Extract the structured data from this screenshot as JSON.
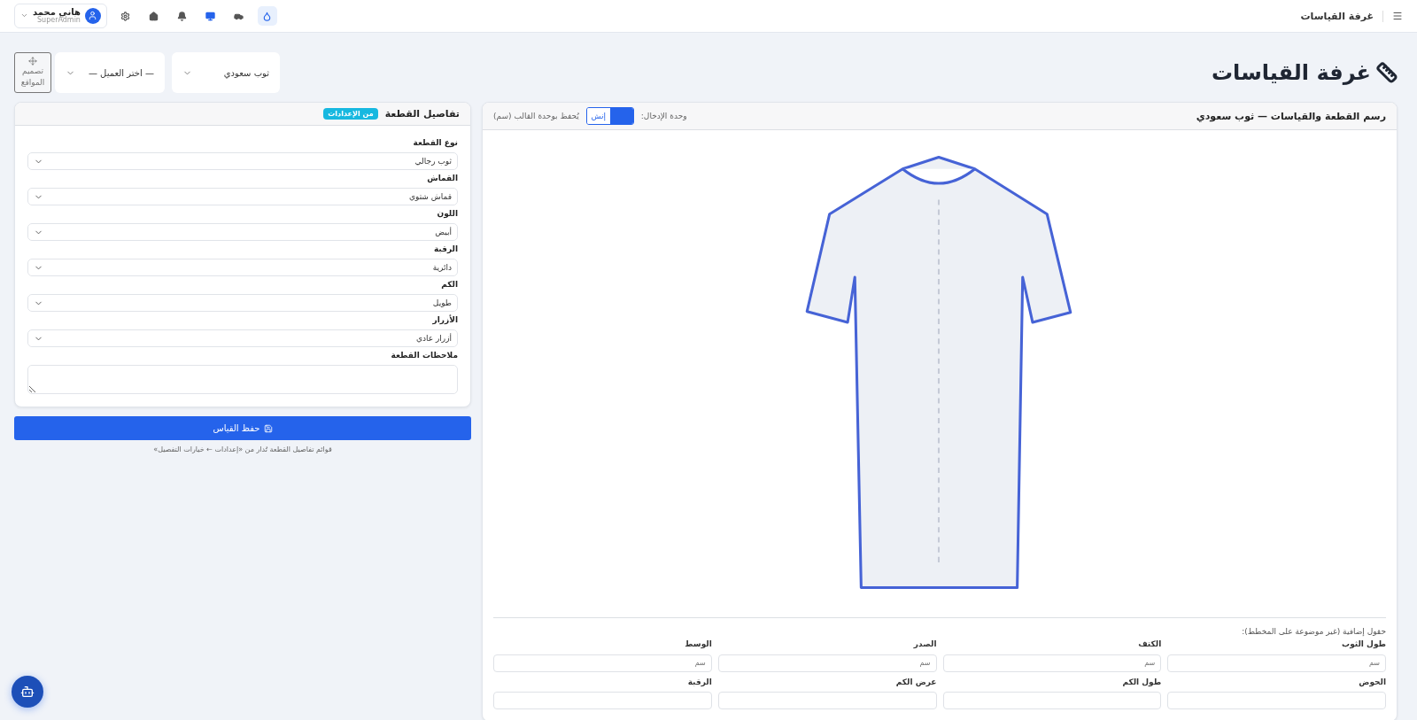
{
  "topbar": {
    "title": "غرفة القياسات",
    "user": {
      "name": "هاني محمد",
      "role": "SuperAdmin"
    },
    "toolbar_icons": [
      {
        "selected": false
      },
      {
        "selected": false
      },
      {
        "selected": false
      },
      {
        "selected": false
      },
      {
        "selected": false
      },
      {
        "selected": true
      }
    ]
  },
  "page_title": "غرفة القياسات",
  "header_controls": {
    "garment_select": "ثوب سعودي",
    "client_select": "— اختر العميل —",
    "layout_button": "تصميم المواقع"
  },
  "drawing_panel": {
    "title": "رسم القطعة والقياسات — ثوب سعودي",
    "unit_label": "وحدة الإدخال:",
    "unit_toggle": [
      {
        "label": "إنش",
        "selected": false
      },
      {
        "selected": true
      }
    ],
    "unit_note": "يُحفظ بوحدة القالب (سم)",
    "extra_heading": "حقول إضافية (غير موضوعة على المخطط):",
    "fields": [
      {
        "label": "طول الثوب",
        "placeholder": "سم"
      },
      {
        "label": "الكتف",
        "placeholder": "سم"
      },
      {
        "label": "الصدر",
        "placeholder": "سم"
      },
      {
        "label": "الوسط",
        "placeholder": "سم"
      },
      {
        "label": "الحوض"
      },
      {
        "label": "طول الكم"
      },
      {
        "label": "عرض الكم"
      },
      {
        "label": "الرقبة"
      }
    ]
  },
  "details_panel": {
    "title": "تفاصيل القطعة",
    "badge": "من الإعدادات",
    "selects": [
      {
        "label": "نوع القطعة",
        "value": "ثوب رجالي"
      },
      {
        "label": "القماش",
        "value": "قماش شتوي"
      },
      {
        "label": "اللون",
        "value": "أبيض"
      },
      {
        "label": "الرقبة",
        "value": "دائرية"
      },
      {
        "label": "الكم",
        "value": "طويل"
      },
      {
        "label": "الأزرار",
        "value": "أزرار عادي"
      }
    ],
    "notes_label": "ملاحظات القطعة"
  },
  "save_button": "حفظ القياس",
  "footnote": "قوائم تفاصيل القطعة تُدار من «إعدادات ← خيارات التفصيل»"
}
